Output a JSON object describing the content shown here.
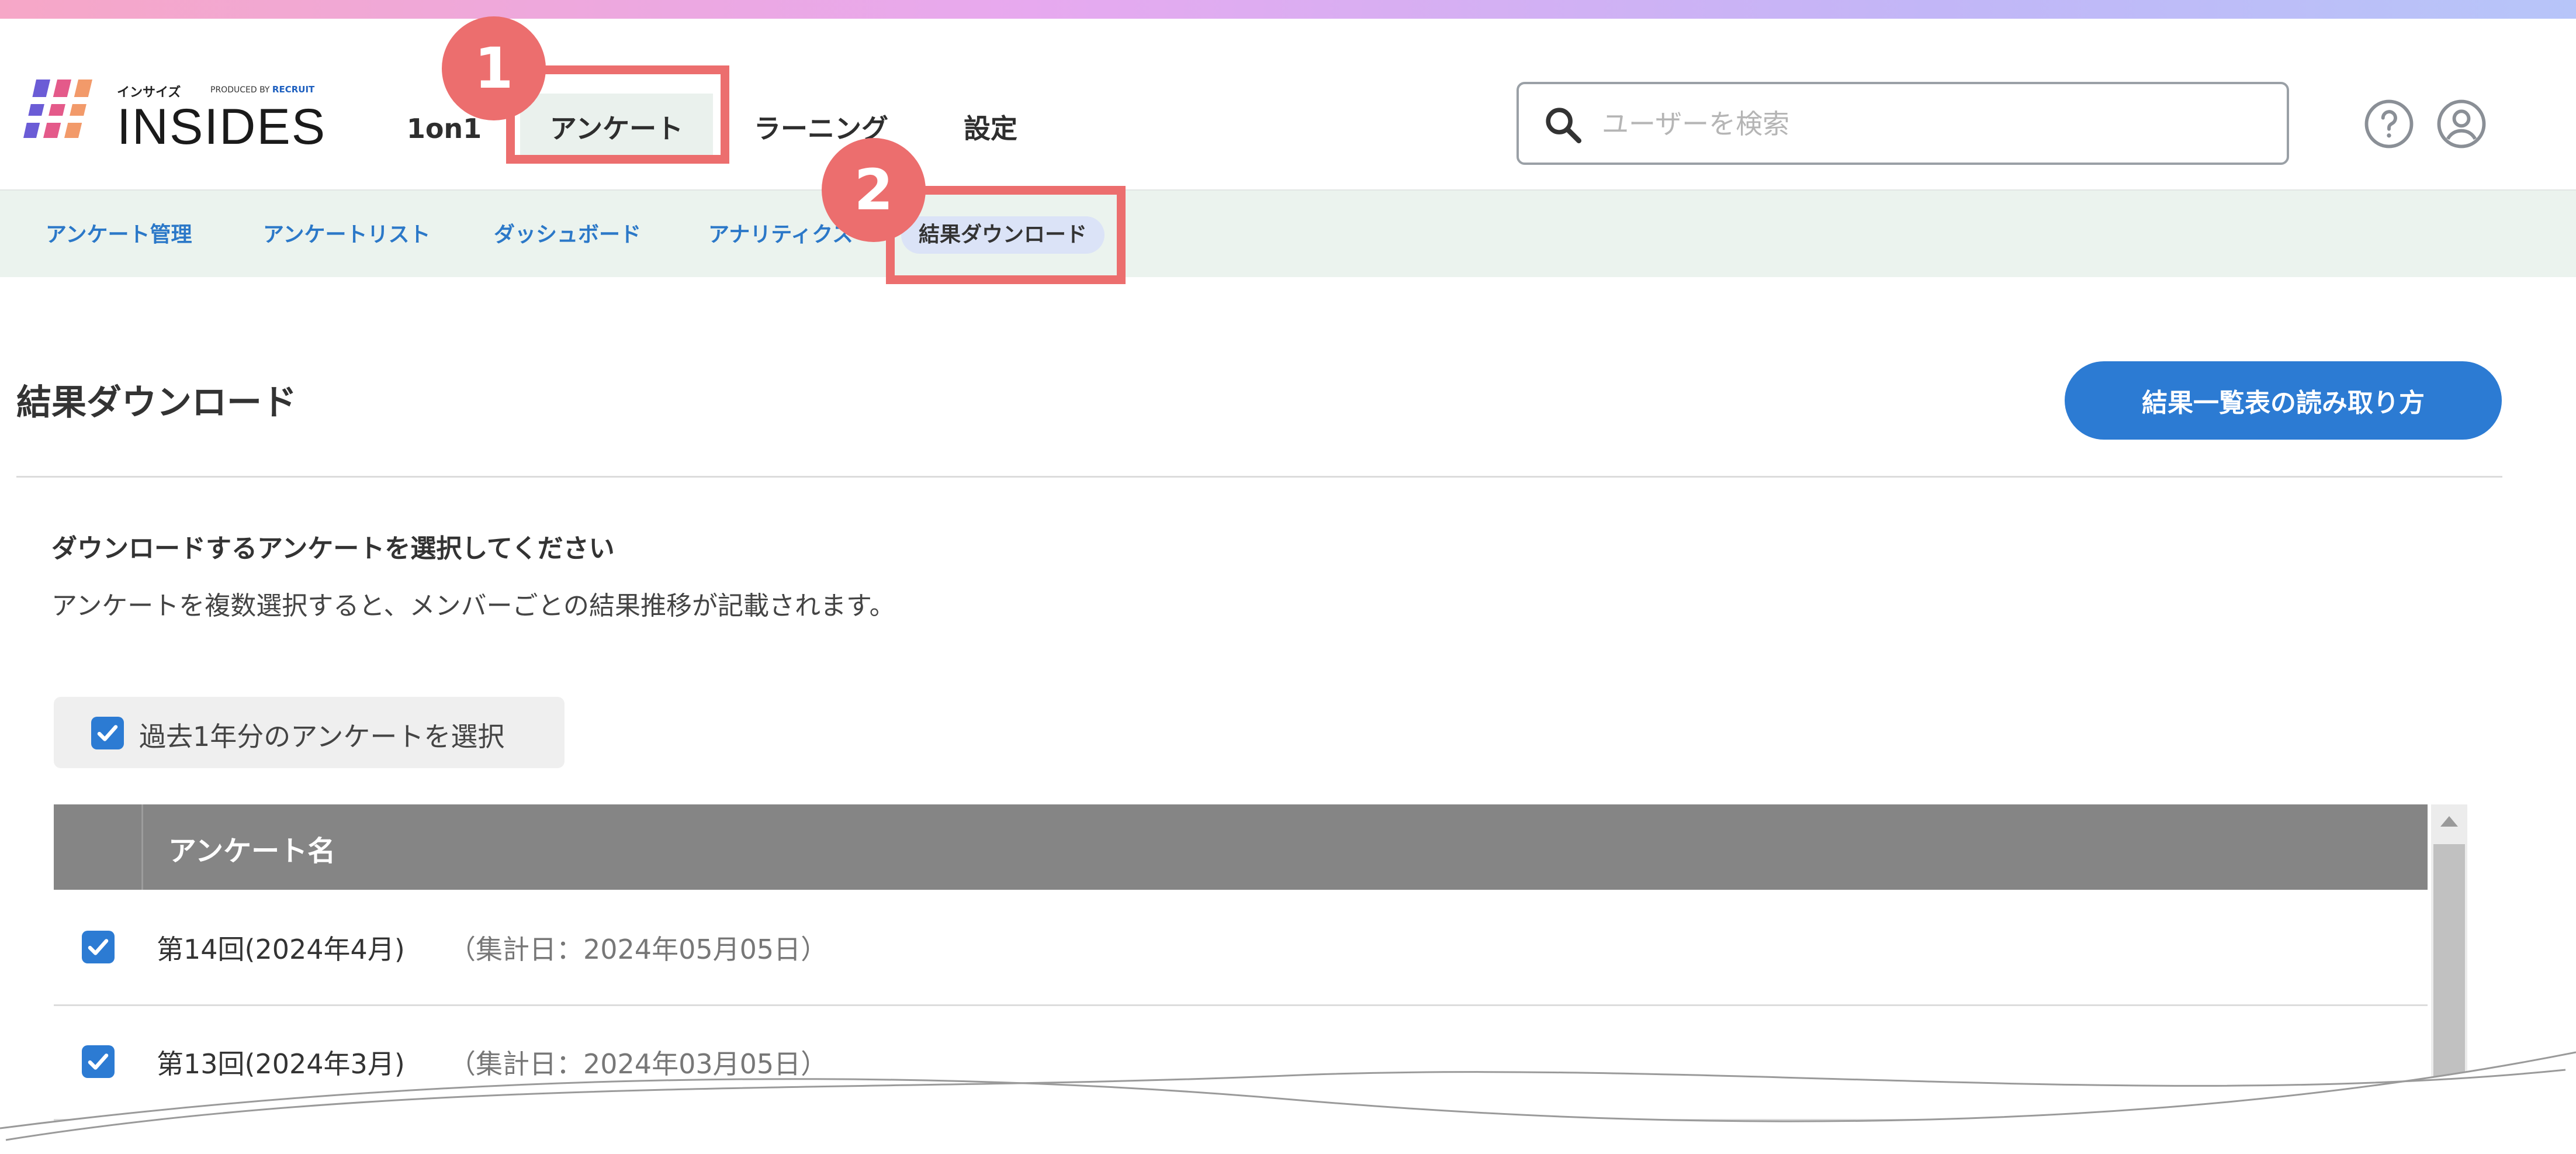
{
  "app": {
    "logo_kana": "インサイズ",
    "logo_produced_by": "PRODUCED BY",
    "logo_recruit": "RECRUIT",
    "logo_name": "INSIDES"
  },
  "nav": {
    "items": [
      {
        "label": "1on1"
      },
      {
        "label": "アンケート",
        "active": true
      },
      {
        "label": "ラーニング"
      },
      {
        "label": "設定"
      }
    ]
  },
  "search": {
    "placeholder": "ユーザーを検索",
    "value": ""
  },
  "header_icons": [
    "help-icon",
    "account-icon"
  ],
  "subnav": {
    "items": [
      {
        "label": "アンケート管理"
      },
      {
        "label": "アンケートリスト"
      },
      {
        "label": "ダッシュボード"
      },
      {
        "label": "アナリティクス"
      },
      {
        "label": "結果ダウンロード",
        "active": true
      }
    ]
  },
  "page": {
    "title": "結果ダウンロード",
    "help_button": "結果一覧表の読み取り方",
    "instruction_title": "ダウンロードするアンケートを選択してください",
    "instruction_desc": "アンケートを複数選択すると、メンバーごとの結果推移が記載されます。",
    "select_past_year": {
      "label": "過去1年分のアンケートを選択",
      "checked": true
    }
  },
  "table": {
    "header": "アンケート名",
    "rows": [
      {
        "name": "第14回(2024年4月)",
        "aggregated": "（集計日：2024年05月05日）",
        "checked": true
      },
      {
        "name": "第13回(2024年3月)",
        "aggregated": "（集計日：2024年03月05日）",
        "checked": true
      }
    ]
  },
  "callouts": [
    {
      "number": "1"
    },
    {
      "number": "2"
    }
  ],
  "colors": {
    "accent": "#2c7bd3",
    "callout": "#ec6e6e",
    "subnav_bg": "#ebf3ee",
    "table_header": "#858585"
  }
}
